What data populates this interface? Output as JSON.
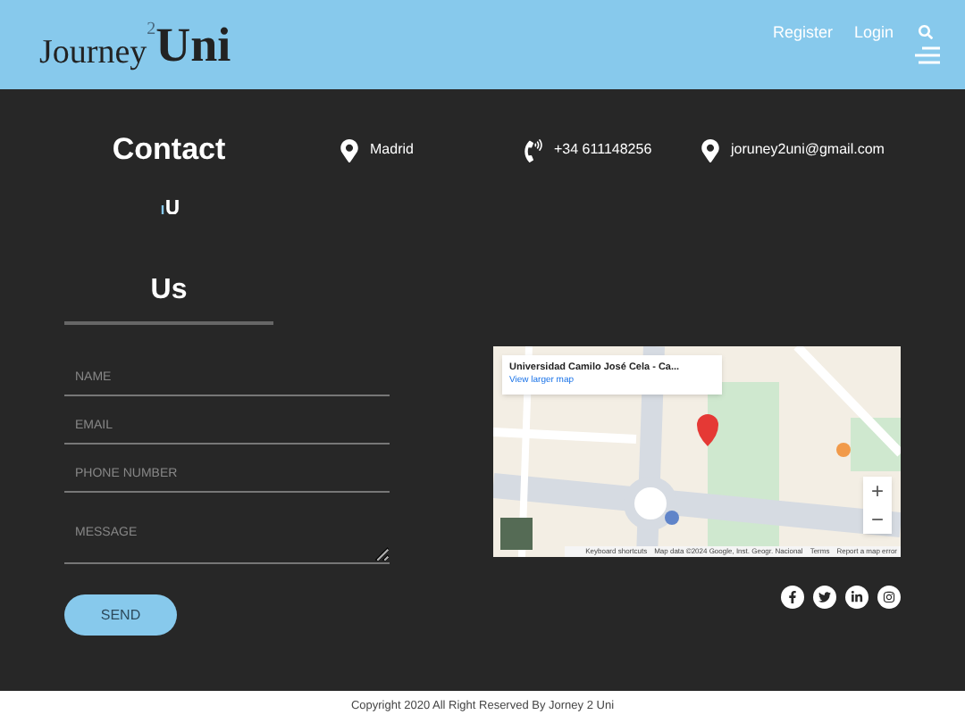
{
  "header": {
    "logo": {
      "text": "Journey",
      "sup": "2",
      "brand": "Uni"
    },
    "links": [
      "Register",
      "Login"
    ]
  },
  "contact": {
    "title": "Contact",
    "items": [
      {
        "kind": "location",
        "text": "Madrid"
      },
      {
        "kind": "phone",
        "text": "+34 611148256"
      },
      {
        "kind": "location",
        "text": "joruney2uni@gmail.com"
      }
    ]
  },
  "form": {
    "title": "Us",
    "fields": [
      {
        "kind": "input",
        "placeholder": "NAME"
      },
      {
        "kind": "input",
        "placeholder": "EMAIL"
      },
      {
        "kind": "input",
        "placeholder": "PHONE NUMBER"
      },
      {
        "kind": "textarea",
        "placeholder": "MESSAGE"
      }
    ],
    "button": "SEND"
  },
  "map": {
    "place": "Universidad Camilo José Cela - Ca...",
    "link": "View larger map",
    "zoom_in": "+",
    "zoom_out": "−",
    "attribution": [
      "Keyboard shortcuts",
      "Map data ©2024 Google, Inst. Geogr. Nacional",
      "Terms",
      "Report a map error"
    ]
  },
  "social": [
    {
      "kind": "facebook"
    },
    {
      "kind": "twitter"
    },
    {
      "kind": "linkedin"
    },
    {
      "kind": "instagram"
    }
  ],
  "footer": "Copyright 2020 All Right Reserved By Jorney 2 Uni"
}
